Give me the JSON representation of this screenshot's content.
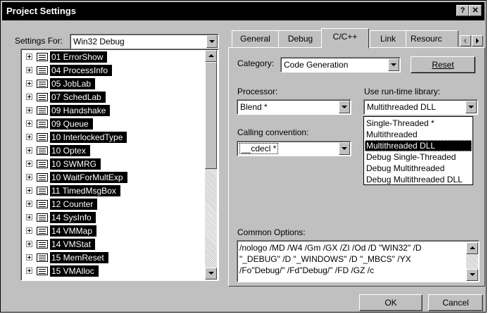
{
  "window": {
    "title": "Project Settings",
    "help_label": "?",
    "close_label": "✕"
  },
  "settings_for": {
    "label": "Settings For:",
    "value": "Win32 Debug"
  },
  "tree": {
    "items": [
      {
        "label": "01 ErrorShow"
      },
      {
        "label": "04 ProcessInfo"
      },
      {
        "label": "05 JobLab"
      },
      {
        "label": "07 SchedLab"
      },
      {
        "label": "09 Handshake"
      },
      {
        "label": "09 Queue"
      },
      {
        "label": "10 InterlockedType"
      },
      {
        "label": "10 Optex"
      },
      {
        "label": "10 SWMRG"
      },
      {
        "label": "10 WaitForMultExp"
      },
      {
        "label": "11 TimedMsgBox"
      },
      {
        "label": "12 Counter"
      },
      {
        "label": "14 SysInfo"
      },
      {
        "label": "14 VMMap"
      },
      {
        "label": "14 VMStat"
      },
      {
        "label": "15 MemReset"
      },
      {
        "label": "15 VMAlloc"
      }
    ]
  },
  "tabs": [
    {
      "label": "General"
    },
    {
      "label": "Debug"
    },
    {
      "label": "C/C++",
      "active": true
    },
    {
      "label": "Link"
    },
    {
      "label": "Resourc"
    }
  ],
  "category": {
    "label": "Category:",
    "value": "Code Generation",
    "reset_label": "Reset"
  },
  "processor": {
    "label": "Processor:",
    "value": "Blend *"
  },
  "calling_convention": {
    "label": "Calling convention:",
    "value": "__cdecl *"
  },
  "runtime_library": {
    "label": "Use run-time library:",
    "value": "Multithreaded DLL",
    "options": [
      "Single-Threaded *",
      "Multithreaded",
      "Multithreaded DLL",
      "Debug Single-Threaded",
      "Debug Multithreaded",
      "Debug Multithreaded DLL"
    ],
    "selected_index": 2
  },
  "common_options": {
    "label": "Common Options:",
    "text": "/nologo /MD /W4 /Gm /GX /ZI /Od /D \"WIN32\" /D\n\"_DEBUG\" /D \"_WINDOWS\" /D \"_MBCS\" /YX\n/Fo\"Debug/\" /Fd\"Debug/\" /FD /GZ /c"
  },
  "buttons": {
    "ok_label": "OK",
    "cancel_label": "Cancel"
  }
}
